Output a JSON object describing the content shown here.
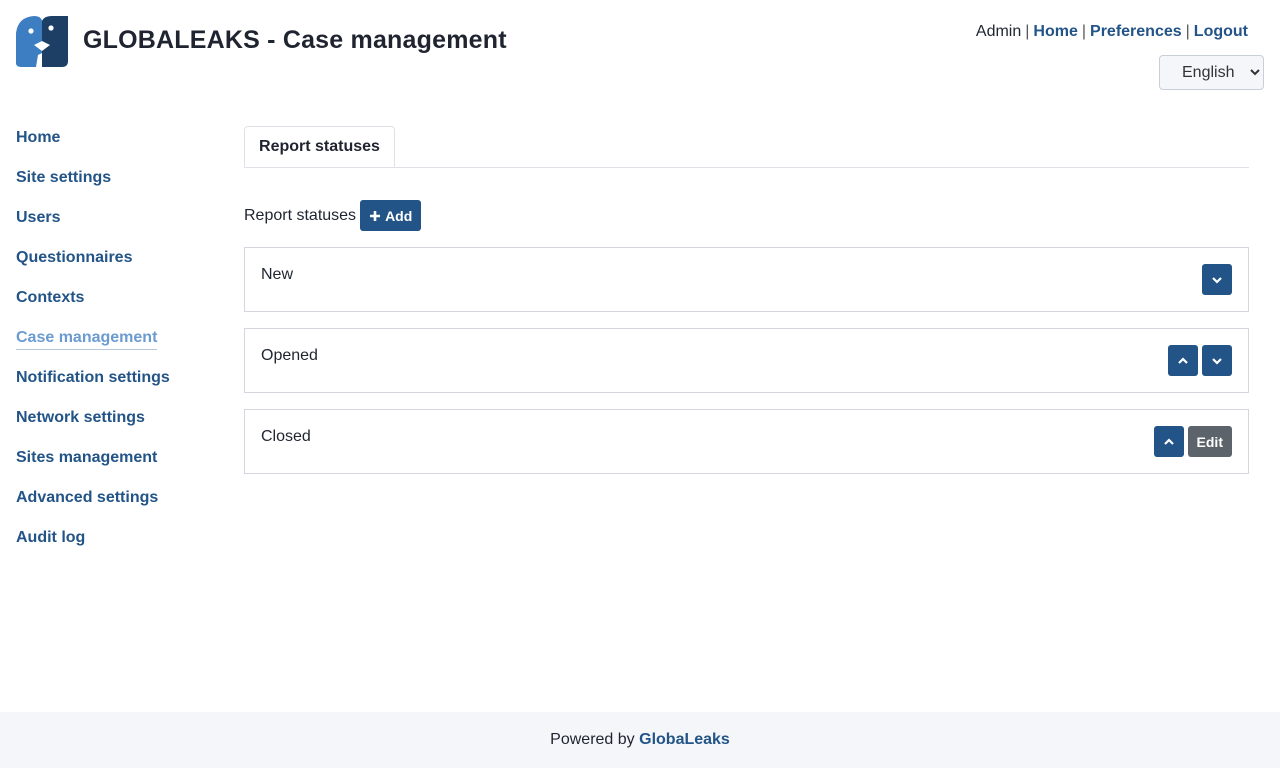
{
  "header": {
    "title": "GLOBALEAKS - Case management",
    "user": "Admin",
    "links": {
      "home": "Home",
      "preferences": "Preferences",
      "logout": "Logout"
    },
    "separator": "|",
    "language": {
      "selected": "English"
    }
  },
  "sidebar": {
    "items": [
      {
        "label": "Home"
      },
      {
        "label": "Site settings"
      },
      {
        "label": "Users"
      },
      {
        "label": "Questionnaires"
      },
      {
        "label": "Contexts"
      },
      {
        "label": "Case management",
        "active": true
      },
      {
        "label": "Notification settings"
      },
      {
        "label": "Network settings"
      },
      {
        "label": "Sites management"
      },
      {
        "label": "Advanced settings"
      },
      {
        "label": "Audit log"
      }
    ]
  },
  "main": {
    "tabs": [
      {
        "label": "Report statuses"
      }
    ],
    "section_title": "Report statuses",
    "add_label": "Add",
    "statuses": [
      {
        "name": "New",
        "actions": [
          "move-down-icon"
        ]
      },
      {
        "name": "Opened",
        "actions": [
          "move-up-icon",
          "move-down-icon"
        ]
      },
      {
        "name": "Closed",
        "actions": [
          "move-up-icon",
          "edit"
        ],
        "edit_label": "Edit"
      }
    ]
  },
  "footer": {
    "prefix": "Powered by",
    "brand": "GlobaLeaks"
  },
  "colors": {
    "primary": "#235487",
    "active": "#6b9bd0",
    "secondary": "#5c636a",
    "footer_bg": "#f4f6fa"
  }
}
